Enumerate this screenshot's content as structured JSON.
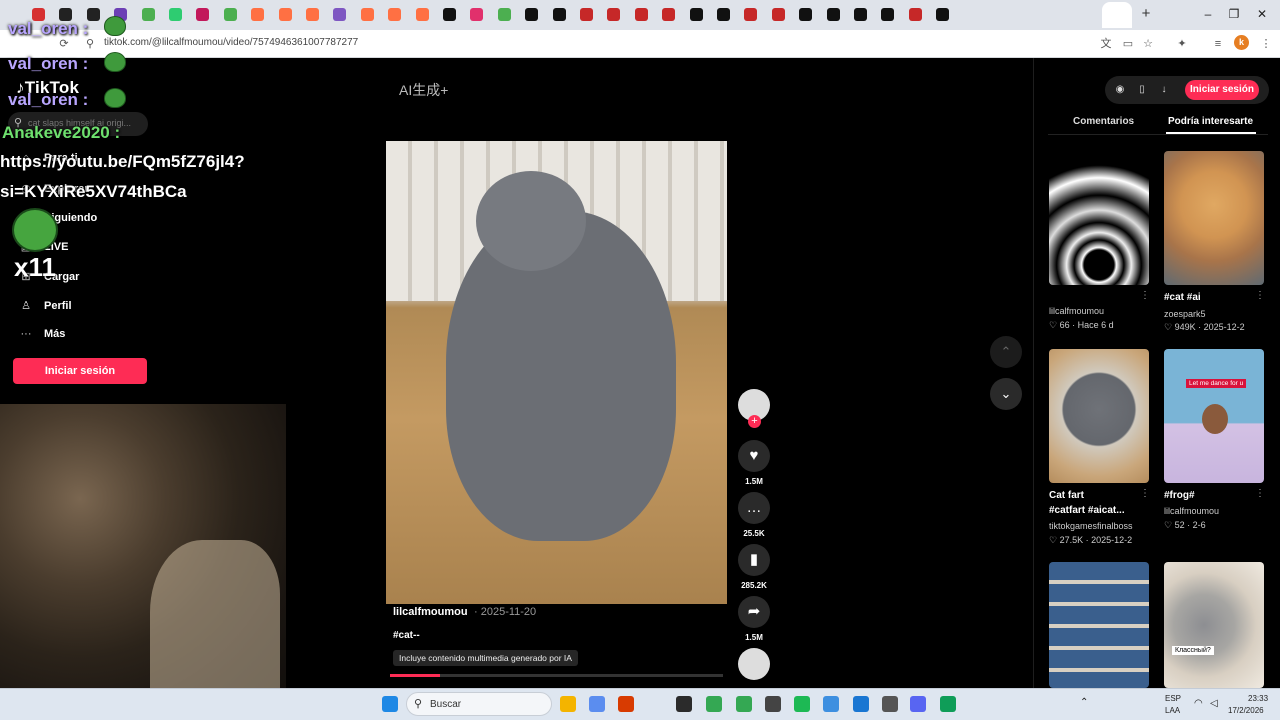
{
  "browser": {
    "url": "tiktok.com/@lilcalfmoumou/video/7574946361007787277",
    "profile_initial": "k",
    "new_tab": "+",
    "minimize": "–",
    "maximize": "❐",
    "close": "✕"
  },
  "sidebar": {
    "logo": "TikTok",
    "search_placeholder": "cat slaps himself ai origi...",
    "nav": [
      {
        "label": "Para ti",
        "icon": "home-icon"
      },
      {
        "label": "Explorar",
        "icon": "compass-icon"
      },
      {
        "label": "Siguiendo",
        "icon": "people-icon"
      },
      {
        "label": "LIVE",
        "icon": "live-icon"
      },
      {
        "label": "Cargar",
        "icon": "upload-icon"
      },
      {
        "label": "Perfil",
        "icon": "user-icon"
      },
      {
        "label": "Más",
        "icon": "more-icon"
      }
    ],
    "login_button": "Iniciar sesión"
  },
  "overlay": {
    "chat_1": "val_oren :",
    "chat_2": "val_oren :",
    "chat_3": "val_oren :",
    "chat_4_user": "Anakeve2020 :",
    "chat_4_line1": "https://youtu.be/FQm5fZ76jl4?",
    "chat_4_line2": "si=KYXiRe5XV74thBCa",
    "multiplier": "x11"
  },
  "video": {
    "ai_tag": "AI生成+",
    "author": "lilcalfmoumou",
    "date": "· 2025-11-20",
    "description": "#cat--",
    "ai_label": "Incluye contenido multimedia generado por IA",
    "progress": 0.15
  },
  "actions": {
    "likes": "1.5M",
    "comments": "25.5K",
    "saves": "285.2K",
    "shares": "1.5M"
  },
  "right_panel": {
    "login_button": "Iniciar sesión",
    "tab_comments": "Comentarios",
    "tab_suggested": "Podría interesarte",
    "videos": [
      {
        "caption": "",
        "author": "lilcalfmoumou",
        "likes": "66",
        "date": "Hace 6 d"
      },
      {
        "caption": "#cat #ai",
        "author": "zoespark5",
        "likes": "949K",
        "date": "2025-12-2"
      },
      {
        "caption": "Cat fart",
        "caption2": "#catfart #aicat...",
        "author": "tiktokgamesfinalboss",
        "likes": "27.5K",
        "date": "2025-12-2"
      },
      {
        "caption": "#frog#",
        "author": "lilcalfmoumou",
        "likes": "52",
        "date": "2-6"
      },
      {
        "thumb_text": ""
      },
      {
        "thumb_text": "Классный?"
      }
    ],
    "frog_thumb_text": "Let me dance for u"
  },
  "taskbar": {
    "search_label": "Buscar",
    "lang_1": "ESP",
    "lang_2": "LAA",
    "time": "23:33",
    "date": "17/2/2026"
  }
}
